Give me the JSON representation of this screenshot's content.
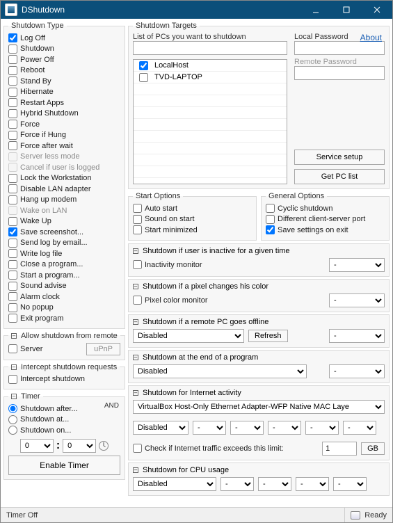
{
  "window": {
    "title": "DShutdown"
  },
  "shutdown_type": {
    "title": "Shutdown Type",
    "items": [
      {
        "label": "Log Off",
        "checked": true,
        "disabled": false
      },
      {
        "label": "Shutdown",
        "checked": false,
        "disabled": false
      },
      {
        "label": "Power Off",
        "checked": false,
        "disabled": false
      },
      {
        "label": "Reboot",
        "checked": false,
        "disabled": false
      },
      {
        "label": "Stand By",
        "checked": false,
        "disabled": false
      },
      {
        "label": "Hibernate",
        "checked": false,
        "disabled": false
      },
      {
        "label": "Restart Apps",
        "checked": false,
        "disabled": false
      },
      {
        "label": "Hybrid Shutdown",
        "checked": false,
        "disabled": false
      },
      {
        "label": "Force",
        "checked": false,
        "disabled": false
      },
      {
        "label": "Force if Hung",
        "checked": false,
        "disabled": false
      },
      {
        "label": "Force after wait",
        "checked": false,
        "disabled": false
      },
      {
        "label": "Server less mode",
        "checked": false,
        "disabled": true
      },
      {
        "label": "Cancel if user is logged",
        "checked": false,
        "disabled": true
      },
      {
        "label": "Lock the Workstation",
        "checked": false,
        "disabled": false
      },
      {
        "label": "Disable LAN adapter",
        "checked": false,
        "disabled": false
      },
      {
        "label": "Hang up modem",
        "checked": false,
        "disabled": false
      },
      {
        "label": "Wake on LAN",
        "checked": false,
        "disabled": true
      },
      {
        "label": "Wake Up",
        "checked": false,
        "disabled": false
      },
      {
        "label": "Save screenshot...",
        "checked": true,
        "disabled": false
      },
      {
        "label": "Send log by email...",
        "checked": false,
        "disabled": false
      },
      {
        "label": "Write log file",
        "checked": false,
        "disabled": false
      },
      {
        "label": "Close a program...",
        "checked": false,
        "disabled": false
      },
      {
        "label": "Start a program...",
        "checked": false,
        "disabled": false
      },
      {
        "label": "Sound advise",
        "checked": false,
        "disabled": false
      },
      {
        "label": "Alarm clock",
        "checked": false,
        "disabled": false
      },
      {
        "label": "No popup",
        "checked": false,
        "disabled": false
      },
      {
        "label": "Exit program",
        "checked": false,
        "disabled": false
      }
    ]
  },
  "allow_remote": {
    "title": "Allow shutdown from remote",
    "server_label": "Server",
    "upnp_button": "uPnP"
  },
  "intercept": {
    "title": "Intercept shutdown requests",
    "option": "Intercept shutdown"
  },
  "timer": {
    "title": "Timer",
    "and_label": "AND",
    "modes": [
      {
        "label": "Shutdown after...",
        "selected": true
      },
      {
        "label": "Shutdown at...",
        "selected": false
      },
      {
        "label": "Shutdown on...",
        "selected": false
      }
    ],
    "hours": "0",
    "minutes": "0",
    "enable_button": "Enable Timer"
  },
  "targets": {
    "title": "Shutdown Targets",
    "about_link": "About",
    "list_label": "List of PCs you want to shutdown",
    "local_pwd_label": "Local Password",
    "remote_pwd_label": "Remote Password",
    "service_setup_button": "Service setup",
    "get_list_button": "Get PC list",
    "pcs": [
      {
        "name": "LocalHost",
        "checked": true
      },
      {
        "name": "TVD-LAPTOP",
        "checked": false
      }
    ]
  },
  "start_options": {
    "title": "Start Options",
    "items": [
      {
        "label": "Auto start",
        "checked": false
      },
      {
        "label": "Sound on start",
        "checked": false
      },
      {
        "label": "Start minimized",
        "checked": false
      }
    ]
  },
  "general_options": {
    "title": "General Options",
    "items": [
      {
        "label": "Cyclic shutdown",
        "checked": false
      },
      {
        "label": "Different client-server port",
        "checked": false
      },
      {
        "label": "Save settings on exit",
        "checked": true
      }
    ]
  },
  "triggers": {
    "inactive": {
      "title": "Shutdown if user is inactive for a given time",
      "check": "Inactivity monitor",
      "select": "-"
    },
    "pixel": {
      "title": "Shutdown if a pixel changes his color",
      "check": "Pixel color monitor",
      "select": "-"
    },
    "offline": {
      "title": "Shutdown if a remote PC goes offline",
      "main_select": "Disabled",
      "refresh": "Refresh",
      "select": "-"
    },
    "program_end": {
      "title": "Shutdown at the end of a program",
      "main_select": "Disabled",
      "select": "-"
    },
    "internet": {
      "title": "Shutdown for Internet activity",
      "adapter": "VirtualBox Host-Only Ethernet Adapter-WFP Native MAC Laye",
      "main_select": "Disabled",
      "s1": "-",
      "s2": "-",
      "s3": "-",
      "s4": "-",
      "s5": "-",
      "limit_check": "Check if Internet traffic exceeds this limit:",
      "limit_value": "1",
      "limit_unit": "GB"
    },
    "cpu": {
      "title": "Shutdown for CPU usage",
      "main_select": "Disabled",
      "s1": "-",
      "s2": "-",
      "s3": "-",
      "s4": "-"
    }
  },
  "statusbar": {
    "left": "Timer Off",
    "right": "Ready"
  }
}
